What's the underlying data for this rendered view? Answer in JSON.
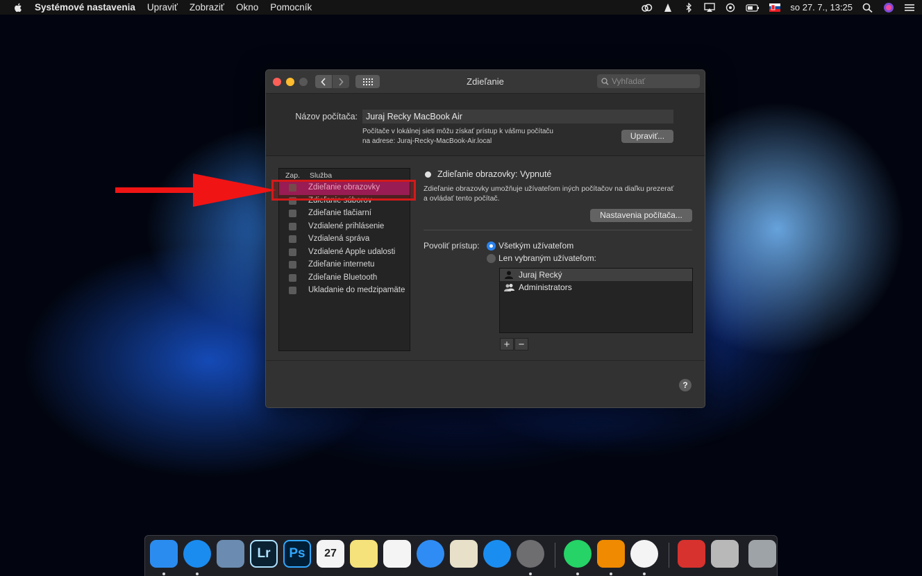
{
  "menubar": {
    "app": "Systémové nastavenia",
    "items": [
      "Upraviť",
      "Zobraziť",
      "Okno",
      "Pomocník"
    ],
    "datetime": "so 27. 7.,  13:25"
  },
  "window": {
    "title": "Zdieľanie",
    "search_placeholder": "Vyhľadať",
    "computer_name_label": "Názov počítača:",
    "computer_name": "Juraj Recky MacBook Air",
    "name_desc_line1": "Počítače v lokálnej sieti môžu získať prístup k vášmu počítaču",
    "name_desc_line2": "na adrese: Juraj-Recky-MacBook-Air.local",
    "edit_button": "Upraviť..."
  },
  "services": {
    "col_on": "Zap.",
    "col_service": "Služba",
    "items": [
      {
        "label": "Zdieľanie obrazovky",
        "selected": true
      },
      {
        "label": "Zdieľanie súborov"
      },
      {
        "label": "Zdieľanie tlačiarní"
      },
      {
        "label": "Vzdialené prihlásenie"
      },
      {
        "label": "Vzdialená správa"
      },
      {
        "label": "Vzdialené Apple udalosti"
      },
      {
        "label": "Zdieľanie internetu"
      },
      {
        "label": "Zdieľanie Bluetooth"
      },
      {
        "label": "Ukladanie do medzipamäte"
      }
    ]
  },
  "detail": {
    "status": "Zdieľanie obrazovky: Vypnuté",
    "desc_line1": "Zdieľanie obrazovky umožňuje užívateľom iných počítačov na diaľku prezerať",
    "desc_line2": "a ovládať tento počítač.",
    "settings_button": "Nastavenia počítača...",
    "allow_label": "Povoliť prístup:",
    "radio_all": "Všetkým užívateľom",
    "radio_selected": "Len vybraným užívateľom:",
    "users": [
      "Juraj Recký",
      "Administrators"
    ],
    "plus": "+",
    "minus": "−",
    "help": "?"
  },
  "dock": {
    "items": [
      {
        "name": "finder-icon",
        "color": "#2b8cf0",
        "text": ""
      },
      {
        "name": "safari-icon",
        "color": "#1a8cf0",
        "text": ""
      },
      {
        "name": "preview-icon",
        "color": "#6b8cb0",
        "text": ""
      },
      {
        "name": "lightroom-icon",
        "color": "#0b2233",
        "text": "Lr"
      },
      {
        "name": "photoshop-icon",
        "color": "#001e36",
        "text": "Ps"
      },
      {
        "name": "calendar-icon",
        "color": "#f4f4f4",
        "text": "27"
      },
      {
        "name": "notes-icon",
        "color": "#f6e27a",
        "text": ""
      },
      {
        "name": "reminders-icon",
        "color": "#f4f4f4",
        "text": ""
      },
      {
        "name": "messages-icon",
        "color": "#2f8cf4",
        "text": ""
      },
      {
        "name": "textedit-icon",
        "color": "#e8e0c8",
        "text": ""
      },
      {
        "name": "app-store-icon",
        "color": "#1a8ef0",
        "text": ""
      },
      {
        "name": "system-preferences-icon",
        "color": "#6e6e70",
        "text": ""
      },
      {
        "name": "whatsapp-icon",
        "color": "#25d366",
        "text": ""
      },
      {
        "name": "vlc-icon",
        "color": "#f08a00",
        "text": ""
      },
      {
        "name": "itunes-icon",
        "color": "#f4f4f4",
        "text": ""
      },
      {
        "name": "creative-cloud-folder-icon",
        "color": "#d8322e",
        "text": ""
      },
      {
        "name": "downloads-stack-icon",
        "color": "#b8b8b8",
        "text": ""
      },
      {
        "name": "trash-icon",
        "color": "#9ea3a8",
        "text": ""
      }
    ]
  }
}
